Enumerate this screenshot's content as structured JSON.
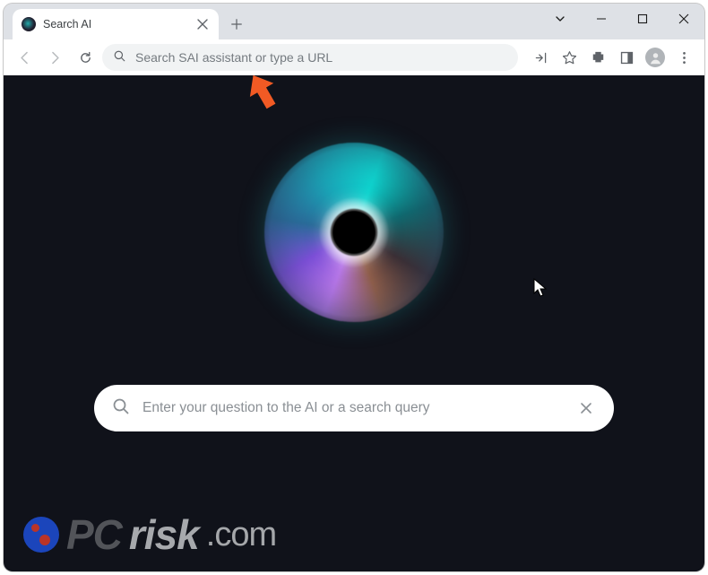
{
  "tab": {
    "title": "Search AI"
  },
  "omnibox": {
    "placeholder": "Search SAI assistant or type a URL"
  },
  "page": {
    "search_placeholder": "Enter your question to the AI or a search query"
  },
  "watermark": {
    "pc": "PC",
    "risk": "risk",
    "com": ".com"
  },
  "icons": {
    "close": "close-icon",
    "newtab": "plus-icon",
    "caret": "chevron-down-icon",
    "minimize": "minimize-icon",
    "maximize": "maximize-icon",
    "winclose": "close-icon",
    "back": "back-icon",
    "forward": "forward-icon",
    "reload": "reload-icon",
    "search": "search-icon",
    "share": "share-icon",
    "star": "star-icon",
    "ext": "puzzle-icon",
    "side": "sidepanel-icon",
    "profile": "profile-icon",
    "menu": "menu-dots-icon",
    "clear": "clear-icon"
  }
}
